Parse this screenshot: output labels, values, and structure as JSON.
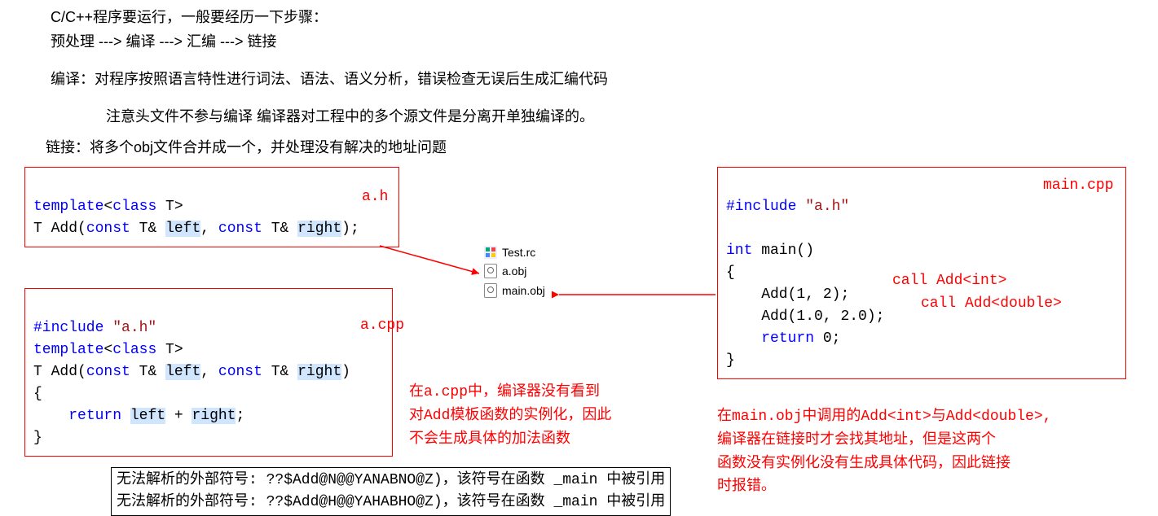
{
  "intro": {
    "line1": "C/C++程序要运行，一般要经历一下步骤：",
    "line2": "预处理 ---> 编译 ---> 汇编 ---> 链接",
    "line3": "编译：对程序按照语言特性进行词法、语法、语义分析，错误检查无误后生成汇编代码",
    "line4": "注意头文件不参与编译 编译器对工程中的多个源文件是分离开单独编译的。",
    "line5": "链接：将多个obj文件合并成一个，并处理没有解决的地址问题"
  },
  "labels": {
    "ah": "a.h",
    "acpp": "a.cpp",
    "maincpp": "main.cpp"
  },
  "code_ah": {
    "t1a": "template",
    "t1b": "<",
    "t1c": "class",
    "t1d": " T>",
    "t2a": "T ",
    "t2b": "Add",
    "t2c": "(",
    "t2d": "const",
    "t2e": " T& ",
    "t2f": "left",
    "t2g": ", ",
    "t2h": "const",
    "t2i": " T& ",
    "t2j": "right",
    "t2k": ");"
  },
  "code_acpp": {
    "l1a": "#include",
    "l1b": " \"a.h\"",
    "l2a": "template",
    "l2b": "<",
    "l2c": "class",
    "l2d": " T>",
    "l3a": "T ",
    "l3b": "Add",
    "l3c": "(",
    "l3d": "const",
    "l3e": " T& ",
    "l3f": "left",
    "l3g": ", ",
    "l3h": "const",
    "l3i": " T& ",
    "l3j": "right",
    "l3k": ")",
    "l4": "{",
    "l5a": "    ",
    "l5b": "return",
    "l5c": " ",
    "l5d": "left",
    "l5e": " + ",
    "l5f": "right",
    "l5g": ";",
    "l6": "}"
  },
  "code_main": {
    "l1a": "#include",
    "l1b": " \"a.h\"",
    "l2a": "int",
    "l2b": " main()",
    "l3": "{",
    "l4a": "    Add(",
    "l4b": "1",
    "l4c": ", ",
    "l4d": "2",
    "l4e": ");",
    "l5a": "    Add(",
    "l5b": "1.0",
    "l5c": ", ",
    "l5d": "2.0",
    "l5e": ");",
    "l6a": "    ",
    "l6b": "return",
    "l6c": " ",
    "l6d": "0",
    "l6e": ";",
    "l7": "}"
  },
  "call_labels": {
    "c1": " call Add<int>",
    "c2": " call Add<double>"
  },
  "files": {
    "f1": "Test.rc",
    "f2": "a.obj",
    "f3": "main.obj"
  },
  "notes": {
    "mid1": "在a.cpp中，编译器没有看到",
    "mid2": "对Add模板函数的实例化，因此",
    "mid3": "不会生成具体的加法函数",
    "right1": "在main.obj中调用的Add<int>与Add<double>,",
    "right2": "编译器在链接时才会找其地址，但是这两个",
    "right3": "函数没有实例化没有生成具体代码，因此链接",
    "right4": "时报错。"
  },
  "errors": {
    "e1": "无法解析的外部符号: ??$Add@N@@YANABNO@Z)，该符号在函数 _main 中被引用",
    "e2": "无法解析的外部符号: ??$Add@H@@YAHABHO@Z)，该符号在函数 _main 中被引用"
  }
}
